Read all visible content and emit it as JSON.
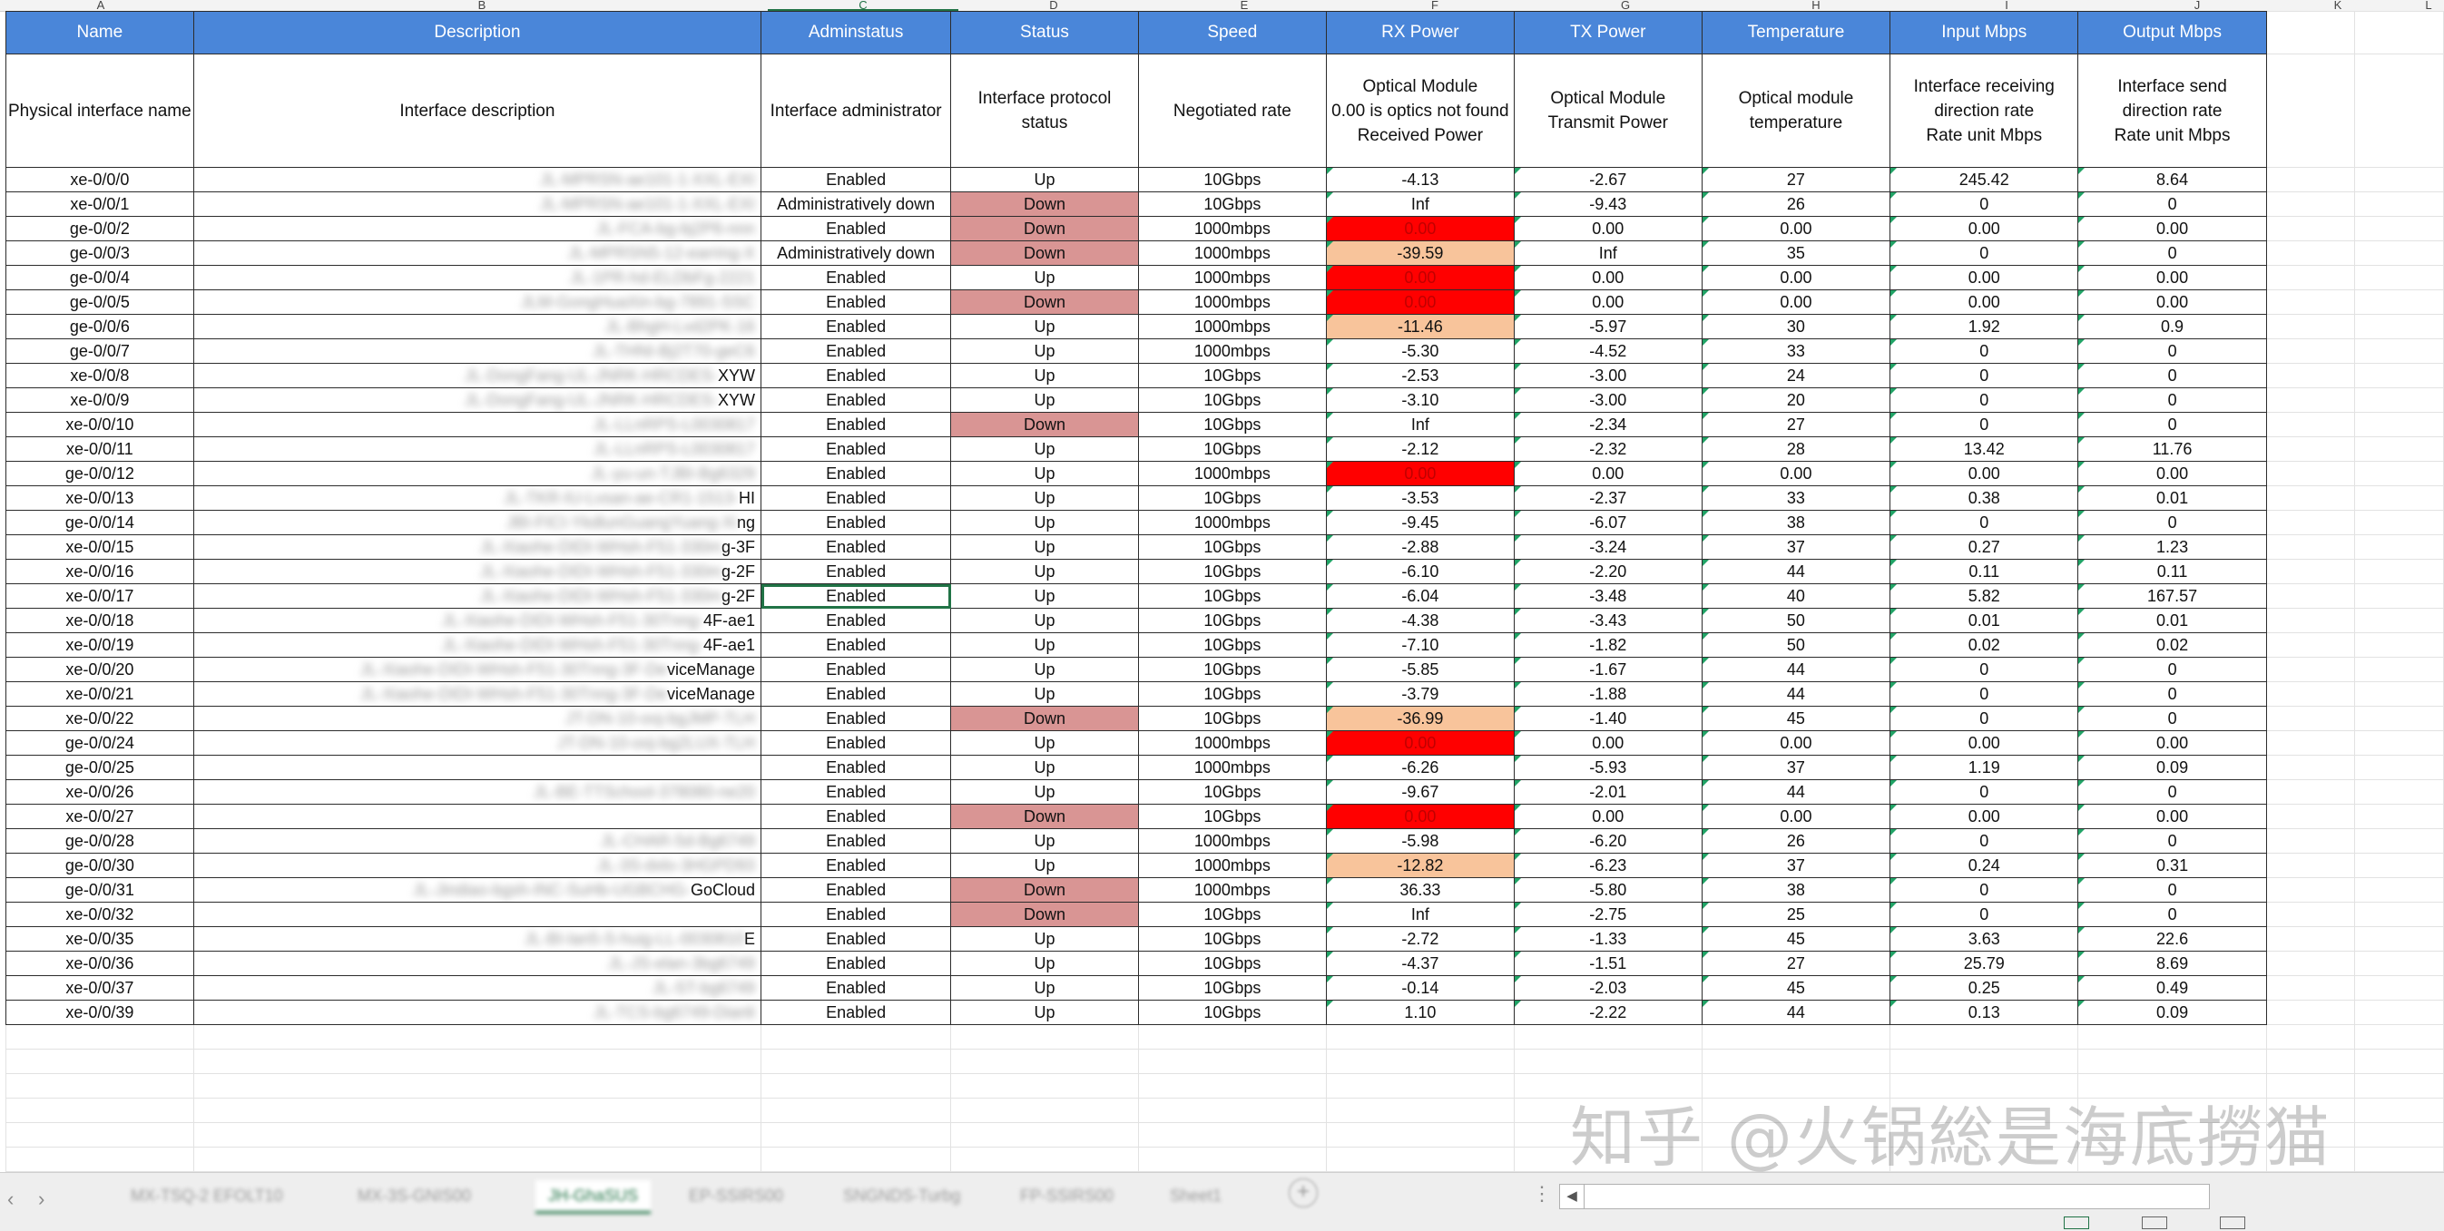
{
  "columns": [
    "A",
    "B",
    "C",
    "D",
    "E",
    "F",
    "G",
    "H",
    "I",
    "J",
    "K",
    "L"
  ],
  "selected_column": "C",
  "headers": [
    "Name",
    "Description",
    "Adminstatus",
    "Status",
    "Speed",
    "RX Power",
    "TX Power",
    "Temperature",
    "Input Mbps",
    "Output Mbps"
  ],
  "descriptions": [
    "Physical interface name",
    "Interface description",
    "Interface administrator",
    "Interface protocol\nstatus",
    "Negotiated rate",
    "Optical Module\n0.00 is optics not found\nReceived Power",
    "Optical Module\nTransmit Power",
    "Optical module\ntemperature",
    "Interface receiving\ndirection rate\nRate unit Mbps",
    "Interface send\ndirection rate\nRate unit Mbps"
  ],
  "rows": [
    {
      "name": "xe-0/0/0",
      "desc_blurred": "JL-MPRSN-ae101-1-XXL-EXI",
      "desc_tail": "",
      "admin": "Enabled",
      "status": "Up",
      "speed": "10Gbps",
      "rx": "-4.13",
      "tx": "-2.67",
      "temp": "27",
      "in": "245.42",
      "out": "8.64"
    },
    {
      "name": "xe-0/0/1",
      "desc_blurred": "JL-MPRSN-ae101-1-XXL-EXI",
      "desc_tail": "",
      "admin": "Administratively down",
      "status": "Down",
      "speed": "10Gbps",
      "rx": "Inf",
      "tx": "-9.43",
      "temp": "26",
      "in": "0",
      "out": "0"
    },
    {
      "name": "ge-0/0/2",
      "desc_blurred": "JL-FCA-bg-bj2P6-nnn",
      "desc_tail": "",
      "admin": "Enabled",
      "status": "Down",
      "speed": "1000mbps",
      "rx": "0.00",
      "tx": "0.00",
      "temp": "0.00",
      "in": "0.00",
      "out": "0.00"
    },
    {
      "name": "ge-0/0/3",
      "desc_blurred": "JL-MPRSN5-12-earring-X",
      "desc_tail": "",
      "admin": "Administratively down",
      "status": "Down",
      "speed": "1000mbps",
      "rx": "-39.59",
      "tx": "Inf",
      "temp": "35",
      "in": "0",
      "out": "0"
    },
    {
      "name": "ge-0/0/4",
      "desc_blurred": "JL-1PR-hd-ELDbFg-2221",
      "desc_tail": "",
      "admin": "Enabled",
      "status": "Up",
      "speed": "1000mbps",
      "rx": "0.00",
      "tx": "0.00",
      "temp": "0.00",
      "in": "0.00",
      "out": "0.00"
    },
    {
      "name": "ge-0/0/5",
      "desc_blurred": "JLM-GongHuaXin-bg-7891-SSC",
      "desc_tail": "",
      "admin": "Enabled",
      "status": "Down",
      "speed": "1000mbps",
      "rx": "0.00",
      "tx": "0.00",
      "temp": "0.00",
      "in": "0.00",
      "out": "0.00"
    },
    {
      "name": "ge-0/0/6",
      "desc_blurred": "JL-BhgH-Lvd2PK-16",
      "desc_tail": "",
      "admin": "Enabled",
      "status": "Up",
      "speed": "1000mbps",
      "rx": "-11.46",
      "tx": "-5.97",
      "temp": "30",
      "in": "1.92",
      "out": "0.9"
    },
    {
      "name": "ge-0/0/7",
      "desc_blurred": "JL-THNI-Bj2T70-geC6",
      "desc_tail": "",
      "admin": "Enabled",
      "status": "Up",
      "speed": "1000mbps",
      "rx": "-5.30",
      "tx": "-4.52",
      "temp": "33",
      "in": "0",
      "out": "0"
    },
    {
      "name": "xe-0/0/8",
      "desc_blurred": "JL-DongFang-UL-JNRK-HRCDES-",
      "desc_tail": "XYW",
      "admin": "Enabled",
      "status": "Up",
      "speed": "10Gbps",
      "rx": "-2.53",
      "tx": "-3.00",
      "temp": "24",
      "in": "0",
      "out": "0"
    },
    {
      "name": "xe-0/0/9",
      "desc_blurred": "JL-DongFang-UL-JNRK-HRCDES-",
      "desc_tail": "XYW",
      "admin": "Enabled",
      "status": "Up",
      "speed": "10Gbps",
      "rx": "-3.10",
      "tx": "-3.00",
      "temp": "20",
      "in": "0",
      "out": "0"
    },
    {
      "name": "xe-0/0/10",
      "desc_blurred": "JL-LLnRPS-L0030817",
      "desc_tail": "",
      "admin": "Enabled",
      "status": "Down",
      "speed": "10Gbps",
      "rx": "Inf",
      "tx": "-2.34",
      "temp": "27",
      "in": "0",
      "out": "0"
    },
    {
      "name": "xe-0/0/11",
      "desc_blurred": "JL-LLnRPS-L0030817",
      "desc_tail": "",
      "admin": "Enabled",
      "status": "Up",
      "speed": "10Gbps",
      "rx": "-2.12",
      "tx": "-2.32",
      "temp": "28",
      "in": "13.42",
      "out": "11.76"
    },
    {
      "name": "ge-0/0/12",
      "desc_blurred": "JL-yu-un-TJBI-Bg6329",
      "desc_tail": "",
      "admin": "Enabled",
      "status": "Up",
      "speed": "1000mbps",
      "rx": "0.00",
      "tx": "0.00",
      "temp": "0.00",
      "in": "0.00",
      "out": "0.00"
    },
    {
      "name": "xe-0/0/13",
      "desc_blurred": "JL-TKR-IU-Lvsan-ae-CR1-1513-",
      "desc_tail": "HI",
      "admin": "Enabled",
      "status": "Up",
      "speed": "10Gbps",
      "rx": "-3.53",
      "tx": "-2.37",
      "temp": "33",
      "in": "0.38",
      "out": "0.01"
    },
    {
      "name": "ge-0/0/14",
      "desc_blurred": "JBI-FICI-YkdlunGuangYuang-Xi",
      "desc_tail": "ng",
      "admin": "Enabled",
      "status": "Up",
      "speed": "1000mbps",
      "rx": "-9.45",
      "tx": "-6.07",
      "temp": "38",
      "in": "0",
      "out": "0"
    },
    {
      "name": "xe-0/0/15",
      "desc_blurred": "JL-Xiaohe-DIDI-WHsh-F51-330m",
      "desc_tail": "g-3F",
      "admin": "Enabled",
      "status": "Up",
      "speed": "10Gbps",
      "rx": "-2.88",
      "tx": "-3.24",
      "temp": "37",
      "in": "0.27",
      "out": "1.23"
    },
    {
      "name": "xe-0/0/16",
      "desc_blurred": "JL-Xiaohe-DIDI-WHsh-F51-330m",
      "desc_tail": "g-2F",
      "admin": "Enabled",
      "status": "Up",
      "speed": "10Gbps",
      "rx": "-6.10",
      "tx": "-2.20",
      "temp": "44",
      "in": "0.11",
      "out": "0.11"
    },
    {
      "name": "xe-0/0/17",
      "desc_blurred": "JL-Xiaohe-DIDI-WHsh-F51-330m",
      "desc_tail": "g-2F",
      "admin": "Enabled",
      "status": "Up",
      "speed": "10Gbps",
      "rx": "-6.04",
      "tx": "-3.48",
      "temp": "40",
      "in": "5.82",
      "out": "167.57"
    },
    {
      "name": "xe-0/0/18",
      "desc_blurred": "JL-Xiaohe-DIDI-WHsh-F51-30Tnng-",
      "desc_tail": "4F-ae1",
      "admin": "Enabled",
      "status": "Up",
      "speed": "10Gbps",
      "rx": "-4.38",
      "tx": "-3.43",
      "temp": "50",
      "in": "0.01",
      "out": "0.01"
    },
    {
      "name": "xe-0/0/19",
      "desc_blurred": "JL-Xiaohe-DIDI-WHsh-F51-30Tnng-",
      "desc_tail": "4F-ae1",
      "admin": "Enabled",
      "status": "Up",
      "speed": "10Gbps",
      "rx": "-7.10",
      "tx": "-1.82",
      "temp": "50",
      "in": "0.02",
      "out": "0.02"
    },
    {
      "name": "xe-0/0/20",
      "desc_blurred": "JL-Xiaohe-DIDI-WHsh-F51-30Tnng-3F-De",
      "desc_tail": "viceManage",
      "admin": "Enabled",
      "status": "Up",
      "speed": "10Gbps",
      "rx": "-5.85",
      "tx": "-1.67",
      "temp": "44",
      "in": "0",
      "out": "0"
    },
    {
      "name": "xe-0/0/21",
      "desc_blurred": "JL-Xiaohe-DIDI-WHsh-F51-30Tnng-3F-De",
      "desc_tail": "viceManage",
      "admin": "Enabled",
      "status": "Up",
      "speed": "10Gbps",
      "rx": "-3.79",
      "tx": "-1.88",
      "temp": "44",
      "in": "0",
      "out": "0"
    },
    {
      "name": "xe-0/0/22",
      "desc_blurred": "JT-DN-10-ooj-bgJMP-TLH",
      "desc_tail": "",
      "admin": "Enabled",
      "status": "Down",
      "speed": "10Gbps",
      "rx": "-36.99",
      "tx": "-1.40",
      "temp": "45",
      "in": "0",
      "out": "0"
    },
    {
      "name": "ge-0/0/24",
      "desc_blurred": "JT-DN-10-ooj-bg2LUX-TLH",
      "desc_tail": "",
      "admin": "Enabled",
      "status": "Up",
      "speed": "1000mbps",
      "rx": "0.00",
      "tx": "0.00",
      "temp": "0.00",
      "in": "0.00",
      "out": "0.00"
    },
    {
      "name": "ge-0/0/25",
      "desc_blurred": "",
      "desc_tail": "",
      "admin": "Enabled",
      "status": "Up",
      "speed": "1000mbps",
      "rx": "-6.26",
      "tx": "-5.93",
      "temp": "37",
      "in": "1.19",
      "out": "0.09"
    },
    {
      "name": "xe-0/0/26",
      "desc_blurred": "JL-BE-TTSchool-378080-ne20",
      "desc_tail": "",
      "admin": "Enabled",
      "status": "Up",
      "speed": "10Gbps",
      "rx": "-9.67",
      "tx": "-2.01",
      "temp": "44",
      "in": "0",
      "out": "0"
    },
    {
      "name": "xe-0/0/27",
      "desc_blurred": "",
      "desc_tail": "",
      "admin": "Enabled",
      "status": "Down",
      "speed": "10Gbps",
      "rx": "0.00",
      "tx": "0.00",
      "temp": "0.00",
      "in": "0.00",
      "out": "0.00"
    },
    {
      "name": "ge-0/0/28",
      "desc_blurred": "JL-CHAR-5d-Bg6749",
      "desc_tail": "",
      "admin": "Enabled",
      "status": "Up",
      "speed": "1000mbps",
      "rx": "-5.98",
      "tx": "-6.20",
      "temp": "26",
      "in": "0",
      "out": "0"
    },
    {
      "name": "ge-0/0/30",
      "desc_blurred": "JL-3S-dxlo-3HGPD93",
      "desc_tail": "",
      "admin": "Enabled",
      "status": "Up",
      "speed": "1000mbps",
      "rx": "-12.82",
      "tx": "-6.23",
      "temp": "37",
      "in": "0.24",
      "out": "0.31"
    },
    {
      "name": "ge-0/0/31",
      "desc_blurred": "JL-Jindiao-bgsh-INC-SuHb-UGBCHG-",
      "desc_tail": "GoCloud",
      "admin": "Enabled",
      "status": "Down",
      "speed": "1000mbps",
      "rx": "36.33",
      "tx": "-5.80",
      "temp": "38",
      "in": "0",
      "out": "0"
    },
    {
      "name": "xe-0/0/32",
      "desc_blurred": "",
      "desc_tail": "",
      "admin": "Enabled",
      "status": "Down",
      "speed": "10Gbps",
      "rx": "Inf",
      "tx": "-2.75",
      "temp": "25",
      "in": "0",
      "out": "0"
    },
    {
      "name": "xe-0/0/35",
      "desc_blurred": "JL-BI-lan5-S-huig-LL-0030810",
      "desc_tail": "E",
      "admin": "Enabled",
      "status": "Up",
      "speed": "10Gbps",
      "rx": "-2.72",
      "tx": "-1.33",
      "temp": "45",
      "in": "3.63",
      "out": "22.6"
    },
    {
      "name": "xe-0/0/36",
      "desc_blurred": "JL-JS-elan-3bg6749",
      "desc_tail": "",
      "admin": "Enabled",
      "status": "Up",
      "speed": "10Gbps",
      "rx": "-4.37",
      "tx": "-1.51",
      "temp": "27",
      "in": "25.79",
      "out": "8.69"
    },
    {
      "name": "xe-0/0/37",
      "desc_blurred": "JL-ST-bg6749",
      "desc_tail": "",
      "admin": "Enabled",
      "status": "Up",
      "speed": "10Gbps",
      "rx": "-0.14",
      "tx": "-2.03",
      "temp": "45",
      "in": "0.25",
      "out": "0.49"
    },
    {
      "name": "xe-0/0/39",
      "desc_blurred": "JL-TCS-bg6749-Dianli",
      "desc_tail": "",
      "admin": "Enabled",
      "status": "Up",
      "speed": "10Gbps",
      "rx": "1.10",
      "tx": "-2.22",
      "temp": "44",
      "in": "0.13",
      "out": "0.09"
    }
  ],
  "sheet_tabs": [
    "MX-TSQ-2 EFOLT10",
    "MX-3S-GNIS00",
    "JH-GhaSUS",
    "EP-SSIRS00",
    "SNGNDS-Turbg",
    "FP-SSIRS00",
    "Sheet1"
  ],
  "active_tab_index": 2,
  "watermark": "知乎 @火锅総是海底撈猫",
  "colors": {
    "header_bg": "#4a86d9",
    "down_bg": "#d99594",
    "rx_bad_bg": "#ff0000",
    "rx_warn_bg": "#f8c49b",
    "excel_green": "#217346"
  }
}
